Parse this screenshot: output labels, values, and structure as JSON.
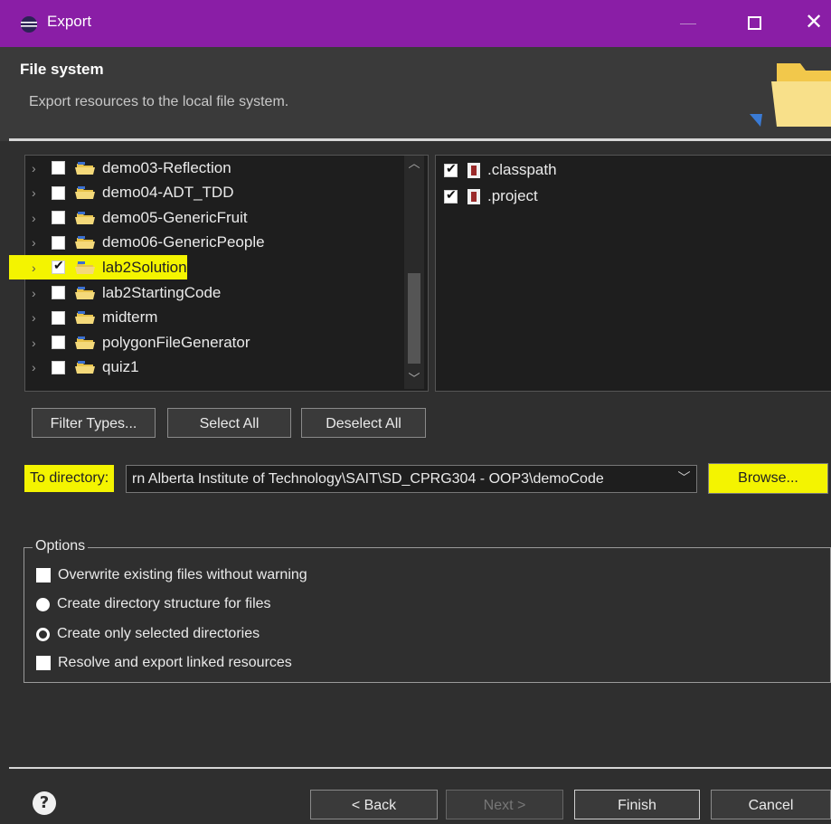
{
  "window": {
    "title": "Export",
    "close_glyph": "✕"
  },
  "header": {
    "title": "File system",
    "description": "Export resources to the local file system."
  },
  "projects": [
    {
      "label": "demo03-Reflection",
      "checked": false,
      "highlighted": false
    },
    {
      "label": "demo04-ADT_TDD",
      "checked": false,
      "highlighted": false
    },
    {
      "label": "demo05-GenericFruit",
      "checked": false,
      "highlighted": false
    },
    {
      "label": "demo06-GenericPeople",
      "checked": false,
      "highlighted": false
    },
    {
      "label": "lab2Solution",
      "checked": true,
      "highlighted": true
    },
    {
      "label": "lab2StartingCode",
      "checked": false,
      "highlighted": false
    },
    {
      "label": "midterm",
      "checked": false,
      "highlighted": false
    },
    {
      "label": "polygonFileGenerator",
      "checked": false,
      "highlighted": false
    },
    {
      "label": "quiz1",
      "checked": false,
      "highlighted": false
    }
  ],
  "files": [
    {
      "label": ".classpath",
      "checked": true
    },
    {
      "label": ".project",
      "checked": true
    }
  ],
  "buttons": {
    "filter_types": "Filter Types...",
    "select_all": "Select All",
    "deselect_all": "Deselect All",
    "browse": "Browse...",
    "back": "< Back",
    "next": "Next >",
    "finish": "Finish",
    "cancel": "Cancel"
  },
  "directory": {
    "label": "To directory:",
    "value": "rn Alberta Institute of Technology\\SAIT\\SD_CPRG304 - OOP3\\demoCode"
  },
  "options": {
    "legend": "Options",
    "overwrite": "Overwrite existing files without warning",
    "create_structure": "Create directory structure for files",
    "create_selected": "Create only selected directories",
    "resolve_linked": "Resolve and export linked resources"
  },
  "colors": {
    "titlebar": "#8a1ea6",
    "highlight": "#f4f400",
    "background": "#2f2f2f"
  }
}
